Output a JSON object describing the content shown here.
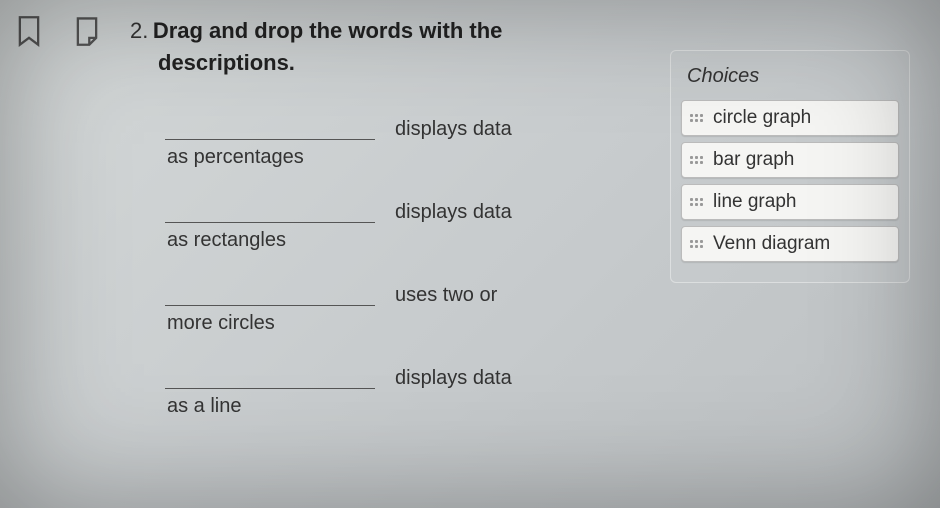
{
  "question": {
    "number": "2.",
    "line1": "Drag and drop the words with the",
    "line2": "descriptions."
  },
  "items": [
    {
      "desc_right": "displays data",
      "after_blank": "as percentages"
    },
    {
      "desc_right": "displays data",
      "after_blank": "as rectangles"
    },
    {
      "desc_right": "uses two or",
      "after_blank": "more circles"
    },
    {
      "desc_right": "displays data",
      "after_blank": "as a line"
    }
  ],
  "choices": {
    "title": "Choices",
    "list": [
      "circle graph",
      "bar graph",
      "line graph",
      "Venn diagram"
    ]
  }
}
